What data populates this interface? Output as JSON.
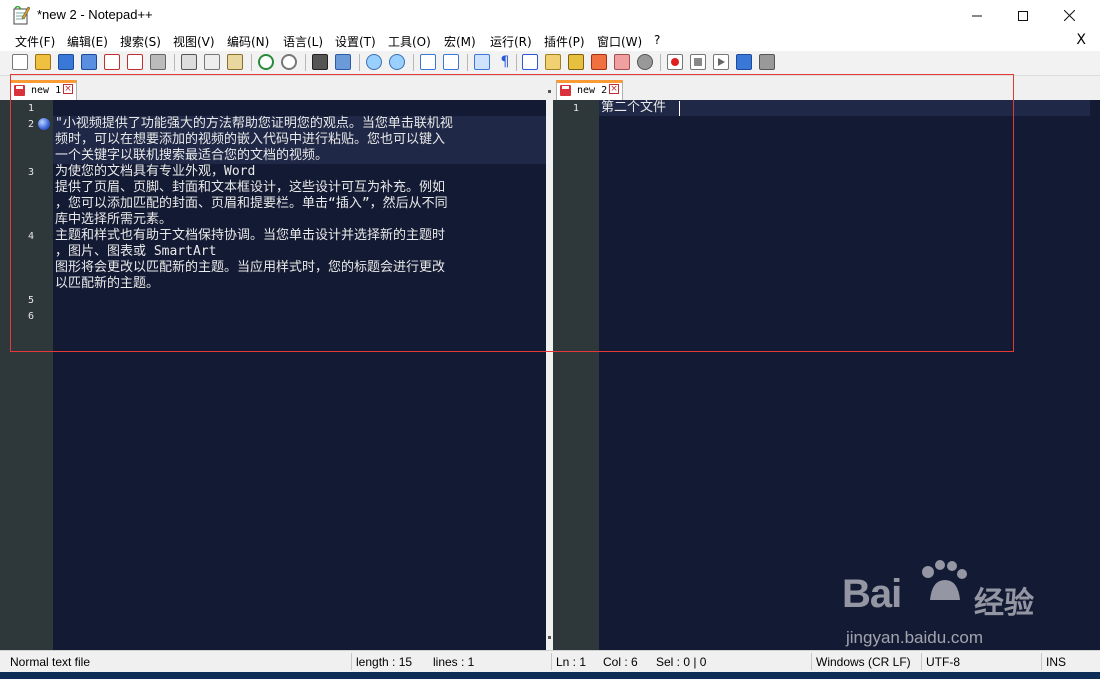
{
  "window": {
    "title": "*new 2 - Notepad++",
    "controls": [
      "minimize",
      "maximize",
      "close"
    ]
  },
  "menu": {
    "items": [
      "文件(F)",
      "编辑(E)",
      "搜索(S)",
      "视图(V)",
      "编码(N)",
      "语言(L)",
      "设置(T)",
      "工具(O)",
      "宏(M)",
      "运行(R)",
      "插件(P)",
      "窗口(W)",
      "?"
    ],
    "close_label": "X"
  },
  "toolbar": {
    "icons": [
      "new-file-icon",
      "open-file-icon",
      "save-icon",
      "save-all-icon",
      "close-icon",
      "close-all-icon",
      "print-icon",
      "cut-icon",
      "copy-icon",
      "paste-icon",
      "undo-icon",
      "redo-icon",
      "find-icon",
      "replace-icon",
      "zoom-in-icon",
      "zoom-out-icon",
      "sync-vertical-icon",
      "sync-horizontal-icon",
      "word-wrap-icon",
      "show-all-chars-icon",
      "indent-guide-icon",
      "document-map-icon",
      "function-list-icon",
      "folder-workspace-icon",
      "monitor-icon",
      "doc-switcher-icon",
      "record-macro-icon",
      "stop-macro-icon",
      "play-macro-icon",
      "run-macro-multiple-icon",
      "save-macro-icon"
    ]
  },
  "left_pane": {
    "tab_label": "new 1",
    "line_numbers": [
      "1",
      "2",
      "3",
      "4",
      "5",
      "6"
    ],
    "lines": [
      "\"小视频提供了功能强大的方法帮助您证明您的观点。当您单击联机视",
      "频时，可以在想要添加的视频的嵌入代码中进行粘贴。您也可以键入",
      "一个关键字以联机搜索最适合您的文档的视频。",
      "为使您的文档具有专业外观，Word",
      "提供了页眉、页脚、封面和文本框设计，这些设计可互为补充。例如",
      "，您可以添加匹配的封面、页眉和提要栏。单击“插入”，然后从不同",
      "库中选择所需元素。",
      "主题和样式也有助于文档保持协调。当您单击设计并选择新的主题时",
      "，图片、图表或 SmartArt",
      "图形将会更改以匹配新的主题。当应用样式时，您的标题会进行更改",
      "以匹配新的主题。"
    ]
  },
  "right_pane": {
    "tab_label": "new 2",
    "line_numbers": [
      "1"
    ],
    "lines": [
      "第二个文件"
    ]
  },
  "status": {
    "file_type": "Normal text file",
    "length": "length : 15",
    "lines": "lines : 1",
    "ln": "Ln : 1",
    "col": "Col : 6",
    "sel": "Sel : 0 | 0",
    "eol": "Windows (CR LF)",
    "encoding": "UTF-8",
    "mode": "INS"
  },
  "watermark": {
    "brand": "Bai",
    "brand_suffix": "经验",
    "url": "jingyan.baidu.com"
  },
  "colors": {
    "editor_bg": "#131a33",
    "gutter_bg": "#2e373a",
    "tab_accent": "#fa9a35",
    "highlight_box": "#e53838"
  }
}
